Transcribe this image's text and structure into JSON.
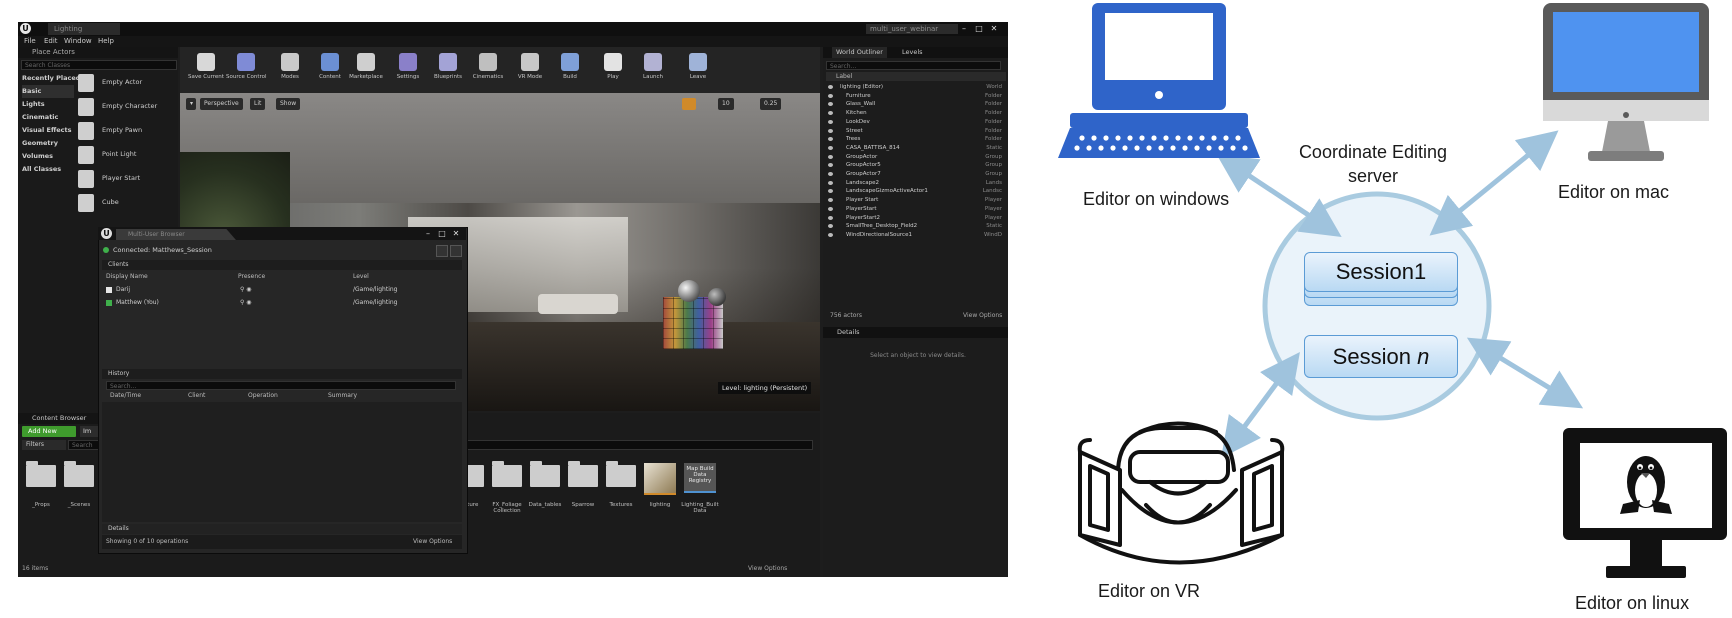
{
  "editor": {
    "window_tab": "Lighting",
    "webinar_tab": "multi_user_webinar",
    "menu": [
      "File",
      "Edit",
      "Window",
      "Help"
    ],
    "place_actors": {
      "title": "Place Actors",
      "search_placeholder": "Search Classes",
      "categories": [
        "Recently Placed",
        "Basic",
        "Lights",
        "Cinematic",
        "Visual Effects",
        "Geometry",
        "Volumes",
        "All Classes"
      ],
      "selected_category": "Basic",
      "actors": [
        "Empty Actor",
        "Empty Character",
        "Empty Pawn",
        "Point Light",
        "Player Start",
        "Cube"
      ]
    },
    "toolbar": [
      {
        "label": "Save Current",
        "color": "#d8d8d8"
      },
      {
        "label": "Source Control",
        "color": "#7f8bd6"
      },
      {
        "label": "Modes",
        "color": "#c9c9c9"
      },
      {
        "label": "Content",
        "color": "#6b8fd3"
      },
      {
        "label": "Marketplace",
        "color": "#cfcfcf"
      },
      {
        "label": "Settings",
        "color": "#8a80c9"
      },
      {
        "label": "Blueprints",
        "color": "#a3a3d6"
      },
      {
        "label": "Cinematics",
        "color": "#bfbfbf"
      },
      {
        "label": "VR Mode",
        "color": "#c7c7c7"
      },
      {
        "label": "Build",
        "color": "#7fa0d8"
      },
      {
        "label": "Play",
        "color": "#e3e3e3"
      },
      {
        "label": "Launch",
        "color": "#b2b2d3"
      },
      {
        "label": "Leave",
        "color": "#9fb3d8"
      }
    ],
    "viewport": {
      "perspective": "Perspective",
      "lit": "Lit",
      "show": "Show",
      "snap_value": "10",
      "scale_value": "0.25",
      "level_label": "Level: lighting (Persistent)"
    },
    "outliner": {
      "tabs": [
        "World Outliner",
        "Levels"
      ],
      "search_placeholder": "Search...",
      "column": "Label",
      "rows": [
        {
          "label": "lighting (Editor)",
          "type": "World"
        },
        {
          "label": "Furniture",
          "type": "Folder"
        },
        {
          "label": "Glass_Wall",
          "type": "Folder"
        },
        {
          "label": "Kitchen",
          "type": "Folder"
        },
        {
          "label": "LookDev",
          "type": "Folder"
        },
        {
          "label": "Street",
          "type": "Folder"
        },
        {
          "label": "Trees",
          "type": "Folder"
        },
        {
          "label": "CASA_BATTISA_814",
          "type": "Static"
        },
        {
          "label": "GroupActor",
          "type": "Group"
        },
        {
          "label": "GroupActor5",
          "type": "Group"
        },
        {
          "label": "GroupActor7",
          "type": "Group"
        },
        {
          "label": "Landscape2",
          "type": "Lands"
        },
        {
          "label": "LandscapeGizmoActiveActor1",
          "type": "Landsc"
        },
        {
          "label": "Player Start",
          "type": "Player"
        },
        {
          "label": "PlayerStart",
          "type": "Player"
        },
        {
          "label": "PlayerStart2",
          "type": "Player"
        },
        {
          "label": "SmallTree_Desktop_Field2",
          "type": "Static"
        },
        {
          "label": "WindDirectionalSource1",
          "type": "WindD"
        }
      ],
      "count": "756 actors",
      "view_options": "View Options"
    },
    "details": {
      "tab": "Details",
      "empty_msg": "Select an object to view details."
    },
    "multi_user": {
      "title": "Multi-User Browser",
      "connection": "Connected: Matthews_Session",
      "clients_header": "Clients",
      "columns": [
        "Display Name",
        "Presence",
        "Level"
      ],
      "clients": [
        {
          "name": "Darij",
          "level": "/Game/lighting",
          "color": "#e6e6e6"
        },
        {
          "name": "Matthew (You)",
          "level": "/Game/lighting",
          "color": "#3fb04b"
        }
      ],
      "history_header": "History",
      "history_search": "Search...",
      "history_columns": [
        "Date/Time",
        "Client",
        "Operation",
        "Summary"
      ],
      "details_header": "Details",
      "footer": "Showing 0 of 10 operations",
      "view_options": "View Options"
    },
    "content_browser": {
      "title": "Content Browser",
      "add_new": "Add New",
      "import": "Im",
      "filters": "Filters",
      "search": "Search",
      "left_folders": [
        "_Props",
        "_Scenes"
      ],
      "folders": [
        "Nature",
        "FX_Foliage Collection",
        "Data_tables",
        "Sparrow",
        "Textures"
      ],
      "assets": [
        "lighting",
        "Lighting_Built Data"
      ],
      "map_build_label": "Map Build Data Registry",
      "items": "16 items",
      "view_options": "View Options"
    }
  },
  "diagram": {
    "server_label": "Coordinate Editing server",
    "session1": "Session1",
    "session_n_prefix": "Session ",
    "session_n_italic": "n",
    "editors": {
      "windows": "Editor on windows",
      "mac": "Editor on mac",
      "vr": "Editor on VR",
      "linux": "Editor on linux"
    },
    "colors": {
      "circle_fill": "#eaf3fa",
      "circle_stroke": "#a9cbe0",
      "arrow": "#9fc3dd",
      "windows_blue": "#2f64c9",
      "mac_screen": "#4f93f0"
    }
  }
}
